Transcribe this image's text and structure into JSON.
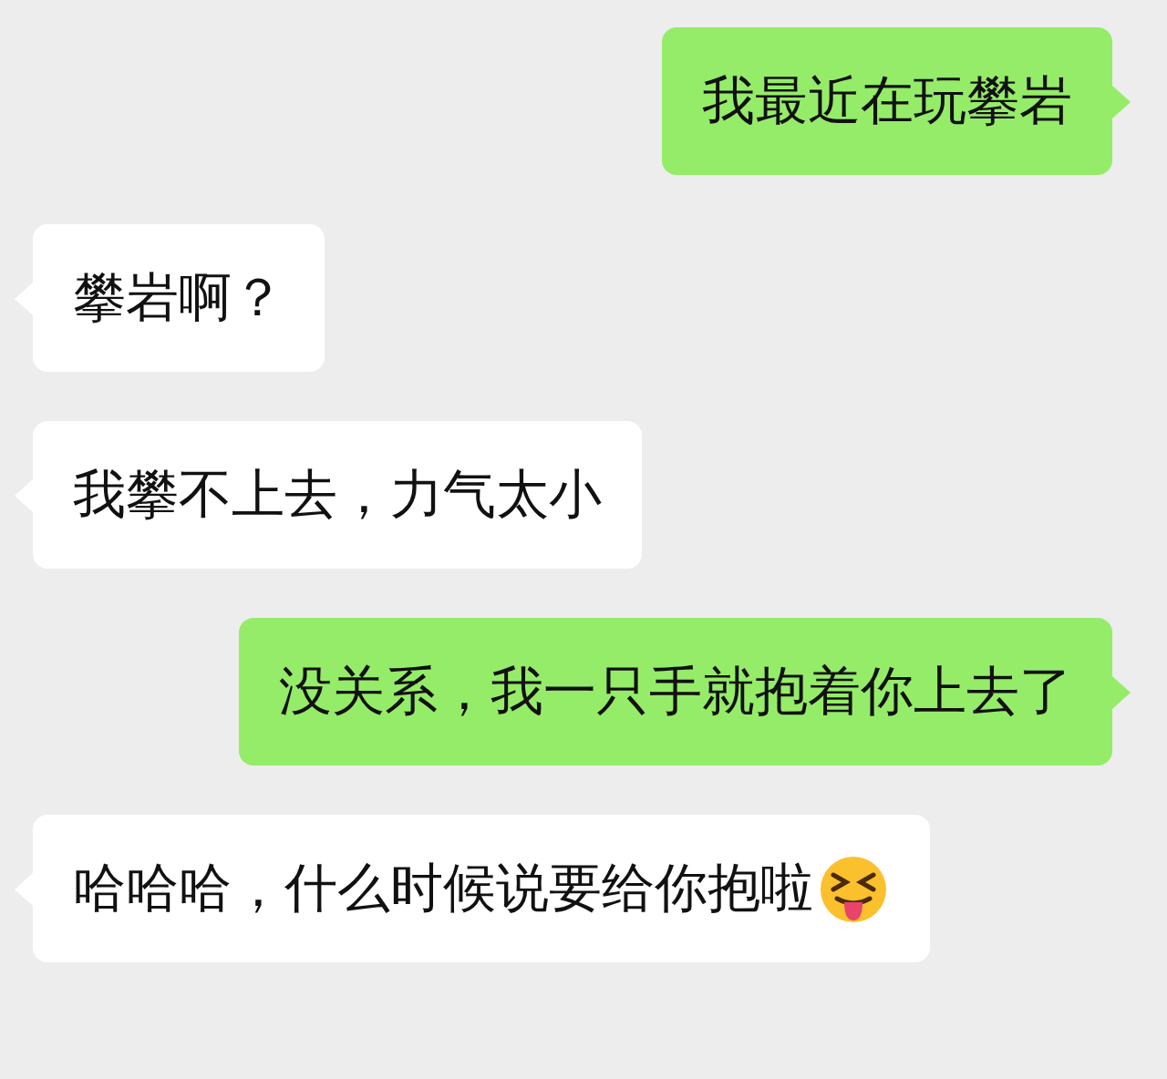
{
  "messages": [
    {
      "kind": "sent",
      "text": "我最近在玩攀岩",
      "emoji": false
    },
    {
      "kind": "received",
      "text": "攀岩啊？",
      "emoji": false
    },
    {
      "kind": "received",
      "text": "我攀不上去，力气太小",
      "emoji": false
    },
    {
      "kind": "sent",
      "text": "没关系，我一只手就抱着你上去了",
      "emoji": false
    },
    {
      "kind": "received",
      "text": "哈哈哈，什么时候说要给你抱啦",
      "emoji": true
    }
  ]
}
